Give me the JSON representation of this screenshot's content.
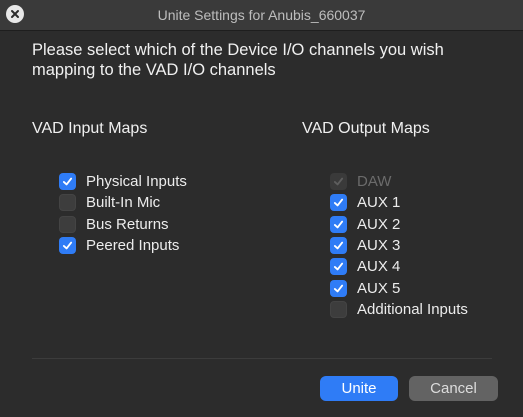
{
  "window": {
    "title": "Unite Settings for Anubis_660037"
  },
  "prompt": {
    "text": "Please select which of the Device I/O channels you wish mapping to the VAD I/O channels"
  },
  "input_maps": {
    "heading": "VAD Input Maps",
    "items": [
      {
        "label": "Physical Inputs",
        "checked": true,
        "disabled": false
      },
      {
        "label": "Built-In Mic",
        "checked": false,
        "disabled": false
      },
      {
        "label": "Bus Returns",
        "checked": false,
        "disabled": false
      },
      {
        "label": "Peered Inputs",
        "checked": true,
        "disabled": false
      }
    ]
  },
  "output_maps": {
    "heading": "VAD Output Maps",
    "items": [
      {
        "label": "DAW",
        "checked": true,
        "disabled": true
      },
      {
        "label": "AUX 1",
        "checked": true,
        "disabled": false
      },
      {
        "label": "AUX 2",
        "checked": true,
        "disabled": false
      },
      {
        "label": "AUX 3",
        "checked": true,
        "disabled": false
      },
      {
        "label": "AUX 4",
        "checked": true,
        "disabled": false
      },
      {
        "label": "AUX 5",
        "checked": true,
        "disabled": false
      },
      {
        "label": "Additional Inputs",
        "checked": false,
        "disabled": false
      }
    ]
  },
  "buttons": {
    "unite": "Unite",
    "cancel": "Cancel"
  },
  "colors": {
    "accent": "#2f7cf6",
    "background": "#2c2c2c",
    "titlebar": "#3a3a3a"
  }
}
